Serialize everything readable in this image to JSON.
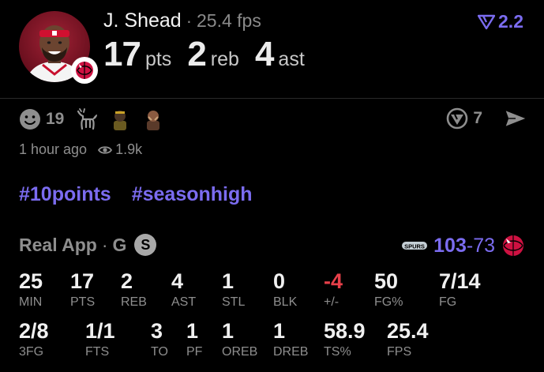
{
  "player": {
    "name": "J. Shead",
    "separator": "·",
    "fps_label": "25.4 fps"
  },
  "statline": [
    {
      "value": "17",
      "unit": "pts"
    },
    {
      "value": "2",
      "unit": "reb"
    },
    {
      "value": "4",
      "unit": "ast"
    }
  ],
  "rating": {
    "value": "2.2",
    "color": "#7b6cf0"
  },
  "reactions": {
    "count": "19",
    "tag_count": "7",
    "icons": [
      "smiley-icon",
      "goat-icon",
      "player-emoji-1",
      "player-emoji-2"
    ]
  },
  "meta": {
    "time": "1 hour ago",
    "views": "1.9k"
  },
  "hashtags": [
    "#10points",
    "#seasonhigh"
  ],
  "game": {
    "source": "Real App",
    "separator": "·",
    "position": "G",
    "status_badge": "S",
    "score_team": "103",
    "score_sep": "-",
    "score_opp": "73"
  },
  "boxscore": [
    {
      "value": "25",
      "label": "MIN"
    },
    {
      "value": "17",
      "label": "PTS"
    },
    {
      "value": "2",
      "label": "REB"
    },
    {
      "value": "4",
      "label": "AST"
    },
    {
      "value": "1",
      "label": "STL"
    },
    {
      "value": "0",
      "label": "BLK"
    },
    {
      "value": "-4",
      "label": "+/-"
    },
    {
      "value": "50",
      "label": "FG%"
    },
    {
      "value": "7/14",
      "label": "FG"
    },
    {
      "value": "2/8",
      "label": "3FG"
    },
    {
      "value": "1/1",
      "label": "FTS"
    },
    {
      "value": "3",
      "label": "TO"
    },
    {
      "value": "1",
      "label": "PF"
    },
    {
      "value": "1",
      "label": "OREB"
    },
    {
      "value": "1",
      "label": "DREB"
    },
    {
      "value": "58.9",
      "label": "TS%"
    },
    {
      "value": "25.4",
      "label": "FPS"
    }
  ],
  "colors": {
    "accent": "#7b6cf0",
    "negative": "#e8404a",
    "muted": "#8e8e8e",
    "raptors": "#ce1141"
  }
}
